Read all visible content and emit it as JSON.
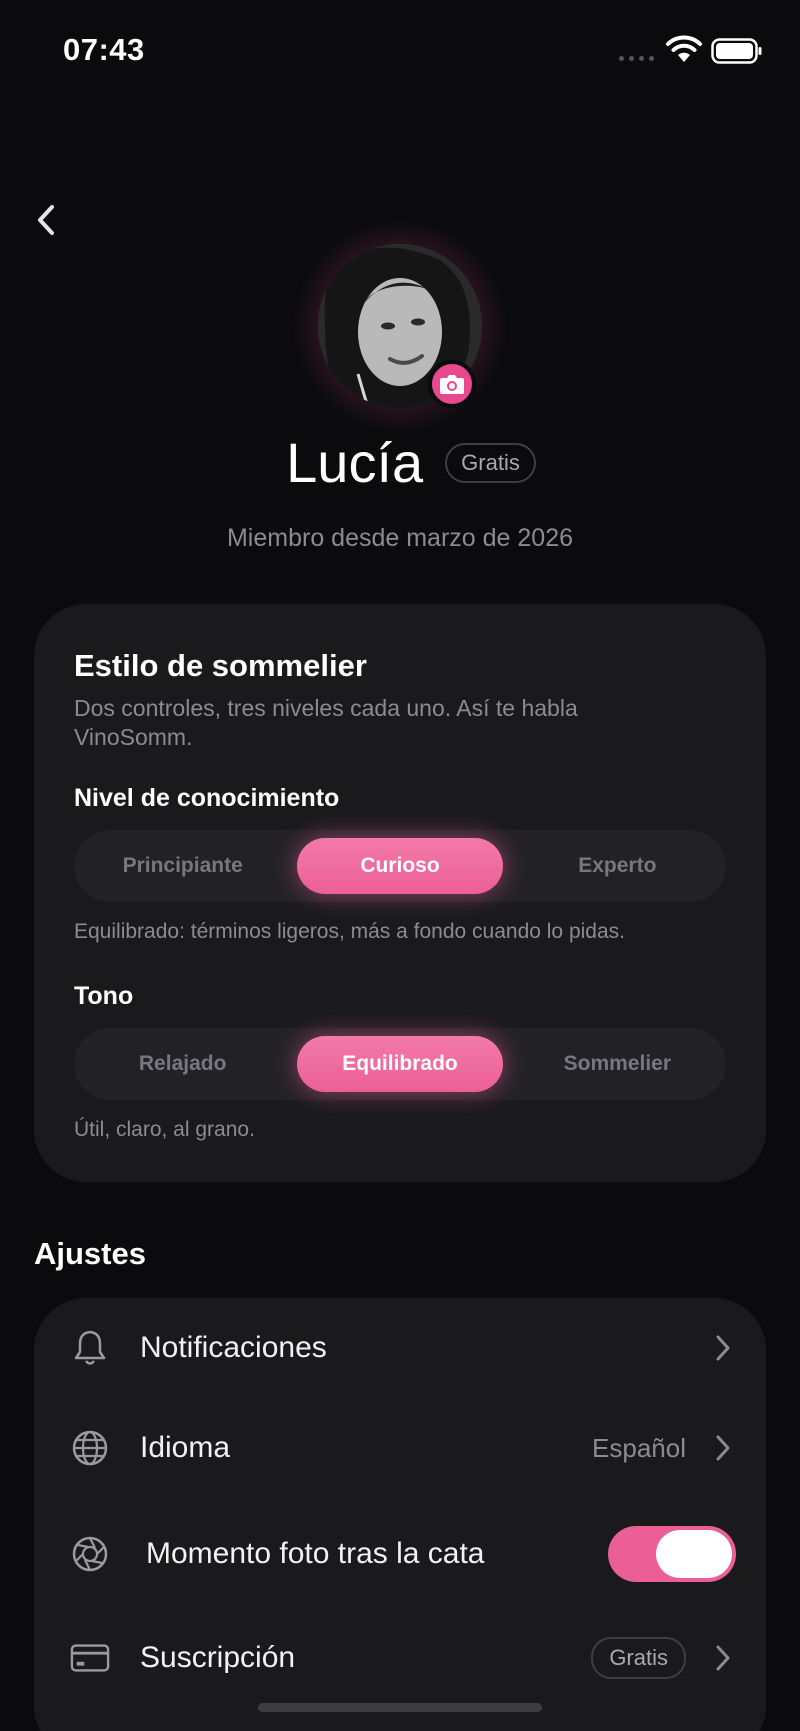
{
  "status_bar": {
    "time": "07:43"
  },
  "profile": {
    "name": "Lucía",
    "plan": "Gratis",
    "member_since": "Miembro desde marzo de 2026"
  },
  "sommelier_style": {
    "title": "Estilo de sommelier",
    "subtitle": "Dos controles, tres niveles cada uno. Así te habla VinoSomm.",
    "knowledge": {
      "label": "Nivel de conocimiento",
      "options": [
        "Principiante",
        "Curioso",
        "Experto"
      ],
      "selected": "Curioso",
      "hint": "Equilibrado: términos ligeros, más a fondo cuando lo pidas."
    },
    "tone": {
      "label": "Tono",
      "options": [
        "Relajado",
        "Equilibrado",
        "Sommelier"
      ],
      "selected": "Equilibrado",
      "hint": "Útil, claro, al grano."
    }
  },
  "settings": {
    "heading": "Ajustes",
    "items": [
      {
        "label": "Notificaciones",
        "icon": "bell-icon"
      },
      {
        "label": "Idioma",
        "value": "Español",
        "icon": "globe-icon"
      },
      {
        "label": "Momento foto tras la cata",
        "icon": "aperture-icon",
        "toggle_on": true
      },
      {
        "label": "Suscripción",
        "badge": "Gratis",
        "icon": "credit-card-icon"
      }
    ]
  },
  "colors": {
    "accent": "#ec5f96",
    "background": "#0b0b0d",
    "card": "#1a1a1d"
  }
}
